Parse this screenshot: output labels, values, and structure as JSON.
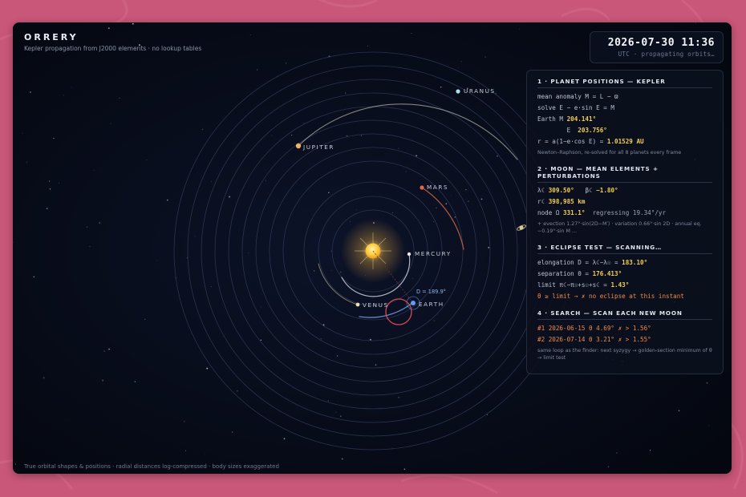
{
  "header": {
    "title": "ORRERY",
    "subtitle": "Kepler propagation from J2000 elements · no lookup tables"
  },
  "clock": {
    "time": "2026-07-30 11:36",
    "status": "UTC · propagating orbits…"
  },
  "planets": {
    "uranus": "URANUS",
    "jupiter": "JUPITER",
    "mars": "MARS",
    "mercury": "MERCURY",
    "venus": "VENUS",
    "earth": "EARTH"
  },
  "orrery": {
    "earth_angle_label": "D = 189.9°"
  },
  "footer": "True orbital shapes & positions · radial distances log-compressed · body sizes exaggerated",
  "panel": {
    "s1": {
      "heading": "1 · PLANET POSITIONS — KEPLER",
      "l1": "mean anomaly  M = L − ϖ",
      "l2": "solve  E − e·sin E = M",
      "l3_prefix": "Earth   M  ",
      "l3_value": "204.141°",
      "l4_prefix": "        E  ",
      "l4_value": "203.756°",
      "l5_prefix": "r = a(1−e·cos E) = ",
      "l5_value": "1.01529 AU",
      "note": "Newton–Raphson, re-solved for all 8 planets every frame"
    },
    "s2": {
      "heading": "2 · MOON — MEAN ELEMENTS + PERTURBATIONS",
      "l1_a": "λ☾ ",
      "l1_b": "309.50°",
      "l1_c": "   β☾ ",
      "l1_d": "−1.80°",
      "l2_a": "r☾ ",
      "l2_b": "398,985 km",
      "l3_a": "node Ω ",
      "l3_b": "331.1°",
      "l3_c": "  regressing 19.34°/yr",
      "note": "+ evection 1.27°·sin(2D−M′) · variation 0.66°·sin 2D · annual eq. −0.19°·sin M …"
    },
    "s3": {
      "heading": "3 · ECLIPSE TEST — SCANNING…",
      "l1_a": "elongation  D = λ☾−λ☉ = ",
      "l1_b": "183.10°",
      "l2_a": "separation  θ = ",
      "l2_b": "176.413°",
      "l3_a": "limit  π☾−π☉+s☉+s☾ = ",
      "l3_b": "1.43°",
      "l4": "θ ≥ limit  →  ✗ no eclipse at this instant"
    },
    "s4": {
      "heading": "4 · SEARCH — SCAN EACH NEW MOON",
      "r1": "#1  2026-06-15  θ 4.69°  ✗ > 1.56°",
      "r2": "#2  2026-07-14  θ 3.21°  ✗ > 1.55°",
      "note": "same loop as the finder: next syzygy → golden-section minimum of θ → limit test"
    }
  },
  "colors": {
    "background": "#c9577a",
    "frame": "#060a17",
    "sun": "#ffd24a",
    "value_yellow": "#f2cf52",
    "warn_orange": "#ef8a4e",
    "earth_blue": "#4d8fe8",
    "moon_ring_red": "#e0455a"
  }
}
